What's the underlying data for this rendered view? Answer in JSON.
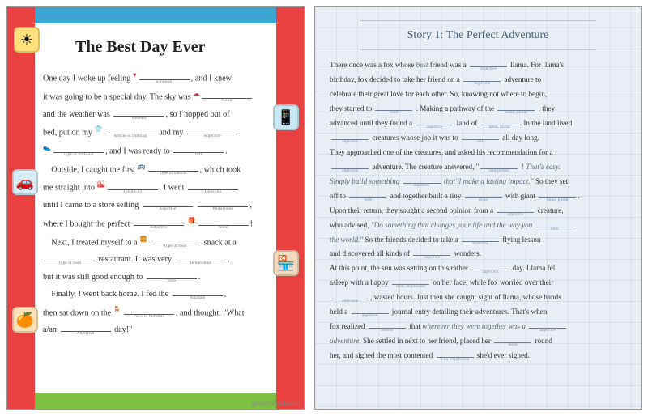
{
  "left": {
    "title": "The Best Day Ever",
    "attribution": "groovyPost.com",
    "icons": {
      "sun": "☀",
      "phone": "📱",
      "car": "🚗",
      "shop": "🏪",
      "fruit": "🍊"
    },
    "story": {
      "l1a": "One day I woke up feeling ",
      "h1": "Emotion",
      "l1b": ", and I knew",
      "l2a": "it was going to be a special day. The sky was ",
      "h2": "Color",
      "l3a": "and the weather was ",
      "h3": "Weather",
      "l3b": ", so I hopped out of",
      "l4a": "bed, put on my ",
      "h4": "Article of clothing",
      "l4b": " and my ",
      "h4b": "Adjective",
      "l5a": "",
      "h5": "Type of footwear",
      "l5b": ", and I was ready to ",
      "h5b": "Verb",
      "l5c": ".",
      "l6a": "Outside, I caught the first ",
      "h6": "Type of vehicle",
      "l6b": ", which took",
      "l7a": "me straight into ",
      "h7": "Town/City",
      "l7b": ". I went ",
      "h7b": "Direction",
      "l8a": "until I came to a store selling ",
      "h8": "Adjective",
      "l8b": " ",
      "h8b": "Plural noun",
      "l8c": ",",
      "l9a": "where I bought the perfect ",
      "h9": "Adjective",
      "l9b": " ",
      "h9b": "Noun",
      "l9c": "!",
      "l10a": "Next, I treated myself to a ",
      "h10": "Type of food",
      "l10b": " snack at a",
      "l11a": "",
      "h11": "Type of food",
      "l11b": " restaurant. It was very ",
      "h11b": "Temperature",
      "l11c": ",",
      "l12a": "but it was still good enough to ",
      "h12": "Verb",
      "l12b": ".",
      "l13a": "Finally, I went back home. I fed the ",
      "h13": "Animals",
      "l13b": ",",
      "l14a": "then sat down on the ",
      "h14": "Piece of furniture",
      "l14b": ", and thought, \"What",
      "l15a": "a/an ",
      "h15": "Adjective",
      "l15b": " day!\""
    }
  },
  "right": {
    "title": "Story 1: The Perfect Adventure",
    "story": {
      "t1": "There once was a fox whose ",
      "best": "best",
      "t1b": " friend was a ",
      "h1": "adjective",
      "t1c": " llama. For llama's",
      "t2": "birthday, fox decided to take her friend on a ",
      "h2": "adjective",
      "t2b": " adventure to",
      "t3": "celebrate their great love for each other. So, knowing not where to begin,",
      "t4": "they started to ",
      "h4": "verb",
      "t4b": " . Making a pathway of the ",
      "h4c": "noun, plural",
      "t4d": " , they",
      "t5": " advanced until they found a ",
      "h5": "adjective",
      "t5b": " land of ",
      "h5c": "noun, plural",
      "t5d": ". In the land lived",
      "t6": "",
      "h6": "adjective",
      "t6b": " creatures whose job it was to ",
      "h6c": "verb",
      "t6d": " all day long.",
      "t7": "They approached one of the creatures, and asked his recommendation for a",
      "t8": "",
      "h8": "adjective",
      "t8b": " adventure. The creature answered, \"",
      "h8c": "interjection",
      "t8d": " ! That's easy.",
      "q1": "Simply build something ",
      "hq1": "adjective",
      "q1b": " that'll make a lasting impact.\"",
      "t9": " So they set",
      "t10": "off to ",
      "h10": "verb",
      "t10b": " and together built a tiny ",
      "h10c": "noun",
      "t10d": " with giant ",
      "h10e": "noun, plural",
      "t10f": ".",
      "t11": "Upon their return, they sought a second opinion from a ",
      "h11": "adjective",
      "t11b": " creature,",
      "t12": "who advised, ",
      "q2": "\"Do something that changes your life and the way you ",
      "hq2": "verb",
      "q2b": "the world.\"",
      "t12b": " So the friends decided to take a ",
      "h12b": "adjective",
      "t12c": " flying lesson",
      "t13": "and discovered all kinds of ",
      "h13": "adjective",
      "t13b": " wonders.",
      "t14": "At this point, the sun was setting on this rather ",
      "h14": "adjective",
      "t14b": " day. Llama fell",
      "t15": "asleep with a happy ",
      "h15": "icon, expression",
      "t15b": " on her face, while fox worried over their",
      "t16": "",
      "h16": "adjective",
      "t16b": ", wasted hours. Just then she caught sight of llama, whose hands",
      "t17": "held a ",
      "h17": "adjective",
      "t17b": " journal entry detailing their adventures. That's when",
      "t18": "fox realized ",
      "h18": "adverb",
      "t18b": " that ",
      "q3": "wherever they were together was a ",
      "hq3": "adjective",
      "q3b": "adventure",
      "t19": ". She settled in next to her friend, placed her ",
      "h19": "noun",
      "t19b": " round",
      "t20": "her, and sighed the most contented ",
      "h20": "icon, expression",
      "t20b": " she'd ever sighed."
    }
  }
}
